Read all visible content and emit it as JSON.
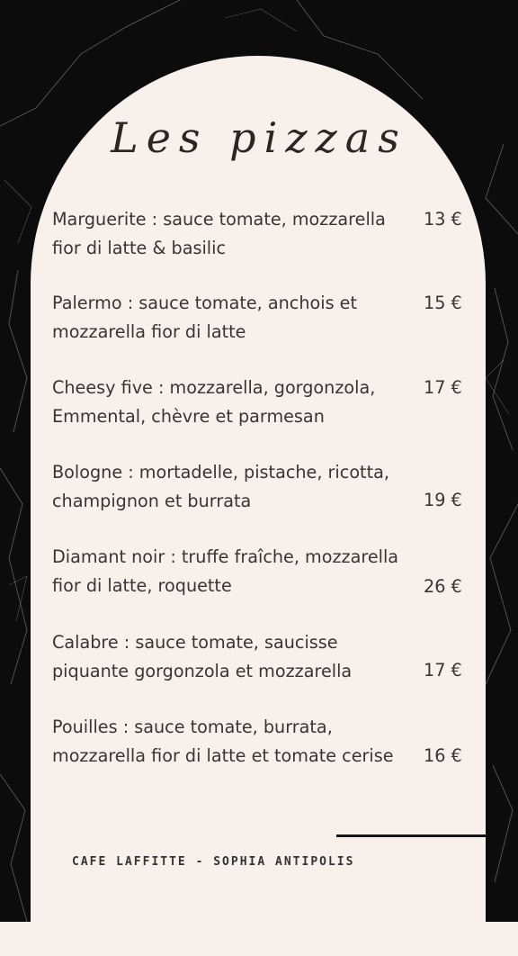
{
  "title": "Les pizzas",
  "items": [
    {
      "name": "Marguerite",
      "sep": " :  ",
      "ingredients": "sauce tomate, mozzarella fior di latte & basilic",
      "price": "13 €"
    },
    {
      "name": "Palermo",
      "sep": " :  ",
      "ingredients": "sauce tomate, anchois et mozzarella fior di latte",
      "price": "15 €"
    },
    {
      "name": "Cheesy five",
      "sep": " : ",
      "ingredients": "mozzarella, gorgonzola, Emmental, chèvre et parmesan",
      "price": "17 €"
    },
    {
      "name": "Bologne",
      "sep": " : ",
      "ingredients": "mortadelle, pistache, ricotta, champignon et burrata",
      "price": "19 €"
    },
    {
      "name": "Diamant noir",
      "sep": " :  ",
      "ingredients": "truffe fraîche, mozzarella fior di latte, roquette",
      "price": "26 €"
    },
    {
      "name": "Calabre",
      "sep": " : ",
      "ingredients": "sauce tomate, saucisse piquante gorgonzola et mozzarella",
      "price": "17 €"
    },
    {
      "name": "Pouilles",
      "sep": " : ",
      "ingredients": "sauce tomate, burrata, mozzarella fior di latte et tomate cerise",
      "price": "16 €"
    }
  ],
  "footer": "CAFE LAFFITTE - SOPHIA ANTIPOLIS",
  "colors": {
    "background": "#f8f0eb",
    "marble": "#0c0c0c",
    "text": "#3a3532"
  }
}
